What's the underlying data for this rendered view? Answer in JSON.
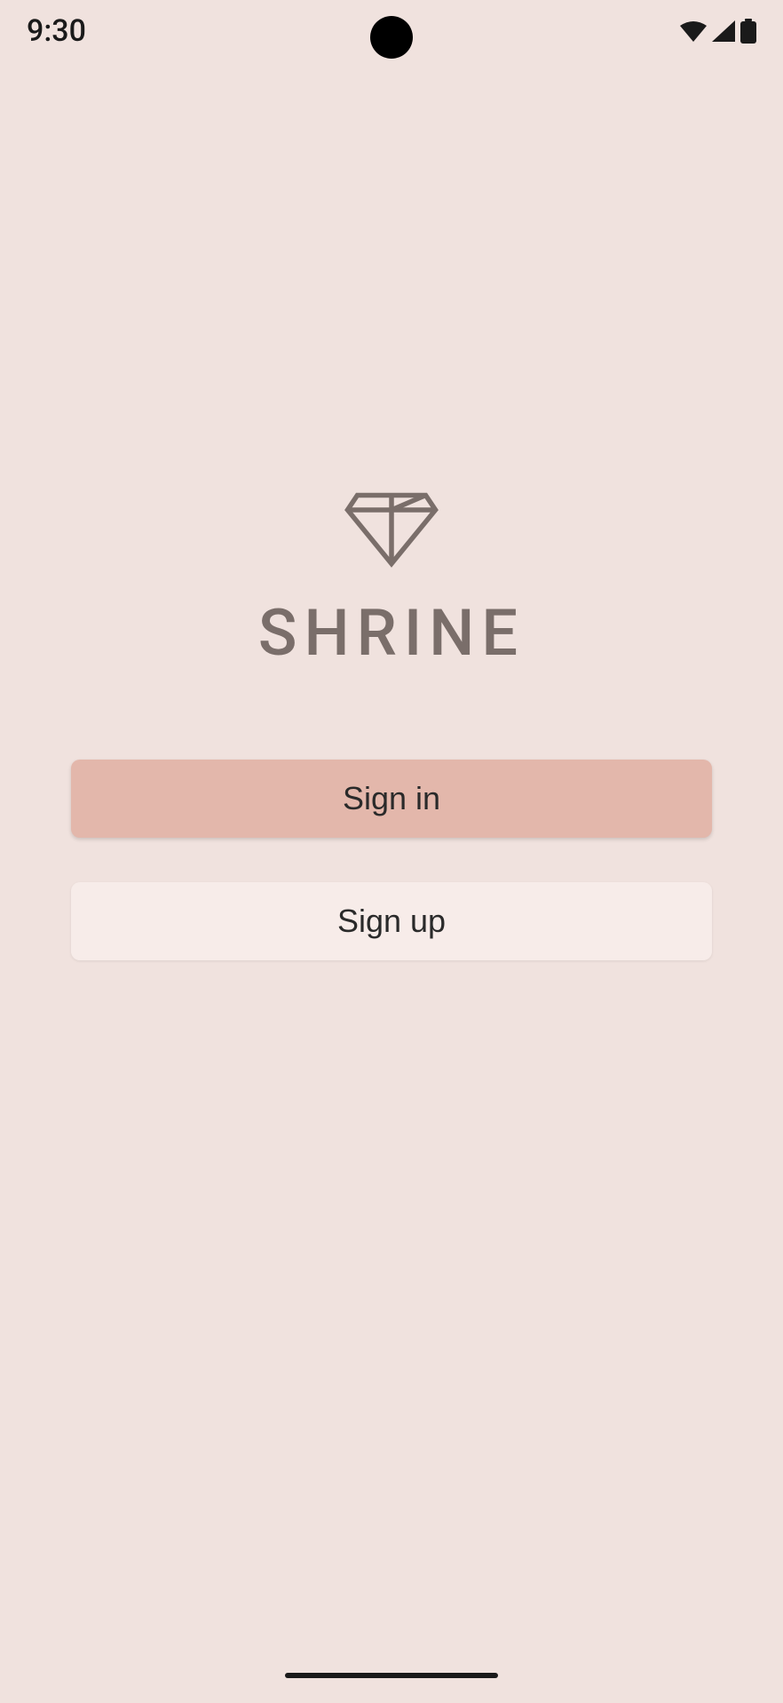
{
  "status": {
    "time": "9:30"
  },
  "app": {
    "title": "SHRINE"
  },
  "buttons": {
    "signin_label": "Sign in",
    "signup_label": "Sign up"
  }
}
